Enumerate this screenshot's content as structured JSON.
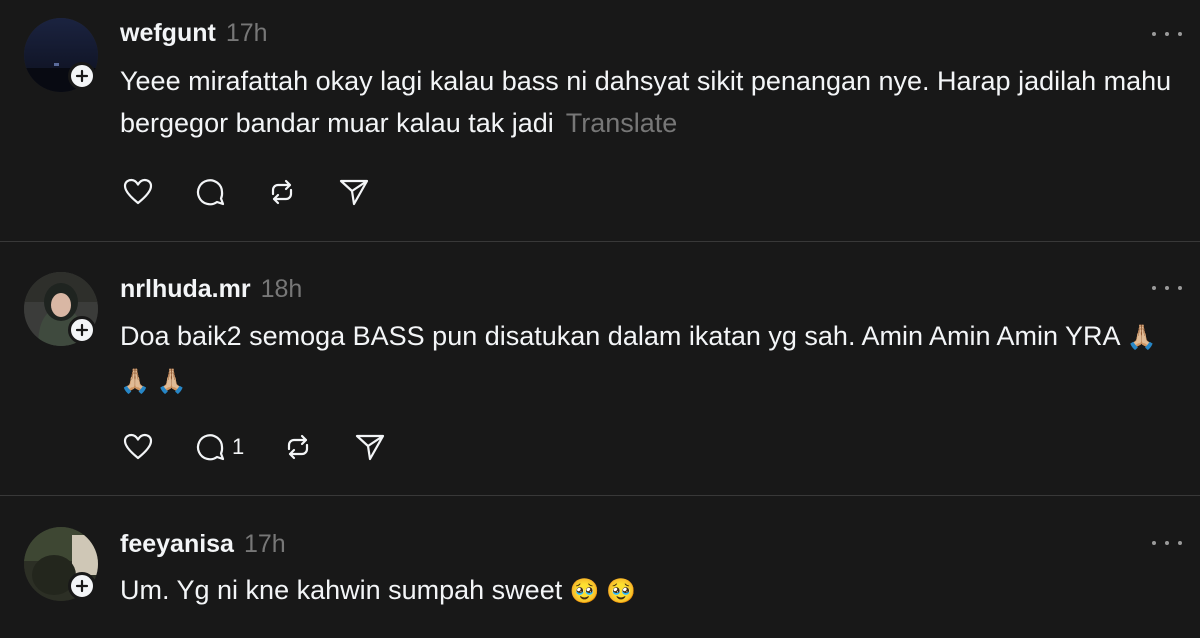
{
  "posts": [
    {
      "username": "wefgunt",
      "time": "17h",
      "text": "Yeee mirafattah okay lagi kalau bass ni dahsyat sikit penangan nye. Harap jadilah mahu bergegor bandar muar kalau tak jadi",
      "translate": "Translate",
      "reply_count": ""
    },
    {
      "username": "nrlhuda.mr",
      "time": "18h",
      "text": "Doa baik2 semoga BASS pun disatukan dalam ikatan yg sah. Amin Amin Amin YRA",
      "emojis": "🙏🏼 🙏🏼 🙏🏼",
      "reply_count": "1"
    },
    {
      "username": "feeyanisa",
      "time": "17h",
      "text": "Um. Yg ni kne kahwin sumpah sweet",
      "emojis": "🥹 🥹"
    }
  ],
  "icons": [
    "heart-icon",
    "comment-icon",
    "repost-icon",
    "share-icon",
    "more-icon",
    "follow-plus-icon"
  ],
  "colors": {
    "background": "#181818",
    "text": "#f3f5f7",
    "muted": "#777777",
    "divider": "#383838"
  }
}
